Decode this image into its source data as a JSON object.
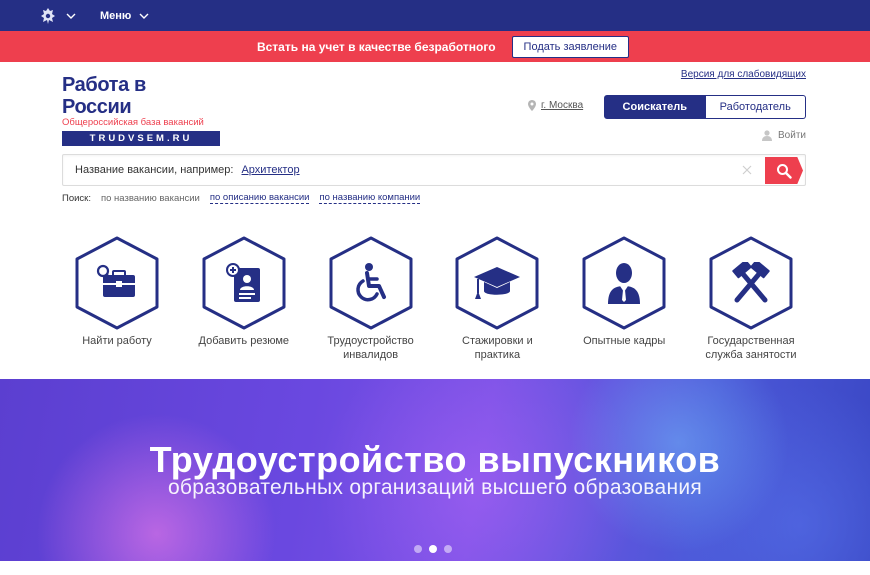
{
  "topnav": {
    "emblem_icon": "coat-of-arms-icon",
    "menu_label": "Меню"
  },
  "promo": {
    "text": "Встать на учет в качестве безработного",
    "button_label": "Подать заявление"
  },
  "logo": {
    "title": "Работа в России",
    "subtitle": "Общероссийская база вакансий",
    "domain": "TRUDVSEM.RU"
  },
  "header": {
    "vision_link": "Версия для слабовидящих",
    "city": "г. Москва",
    "roles": [
      "Соискатель",
      "Работодатель"
    ],
    "login": "Войти"
  },
  "search": {
    "hint": "Название вакансии, например:",
    "example": "Архитектор"
  },
  "filters": {
    "label": "Поиск:",
    "by_title": "по названию вакансии",
    "by_description": "по описанию вакансии",
    "by_company": "по названию компании"
  },
  "tiles": [
    {
      "label": "Найти работу",
      "icon": "briefcase-search-icon"
    },
    {
      "label": "Добавить резюме",
      "icon": "add-resume-icon"
    },
    {
      "label": "Трудоустройство инвалидов",
      "icon": "wheelchair-icon"
    },
    {
      "label": "Стажировки и практика",
      "icon": "graduation-cap-icon"
    },
    {
      "label": "Опытные кадры",
      "icon": "experienced-person-icon"
    },
    {
      "label": "Государственная служба занятости",
      "icon": "hammers-icon"
    }
  ],
  "hero": {
    "title": "Трудоустройство выпускников",
    "subtitle": "образовательных организаций высшего образования",
    "slides": 3,
    "active_slide": 2
  },
  "colors": {
    "brand_blue": "#252f85",
    "brand_red": "#ee3f4e"
  }
}
